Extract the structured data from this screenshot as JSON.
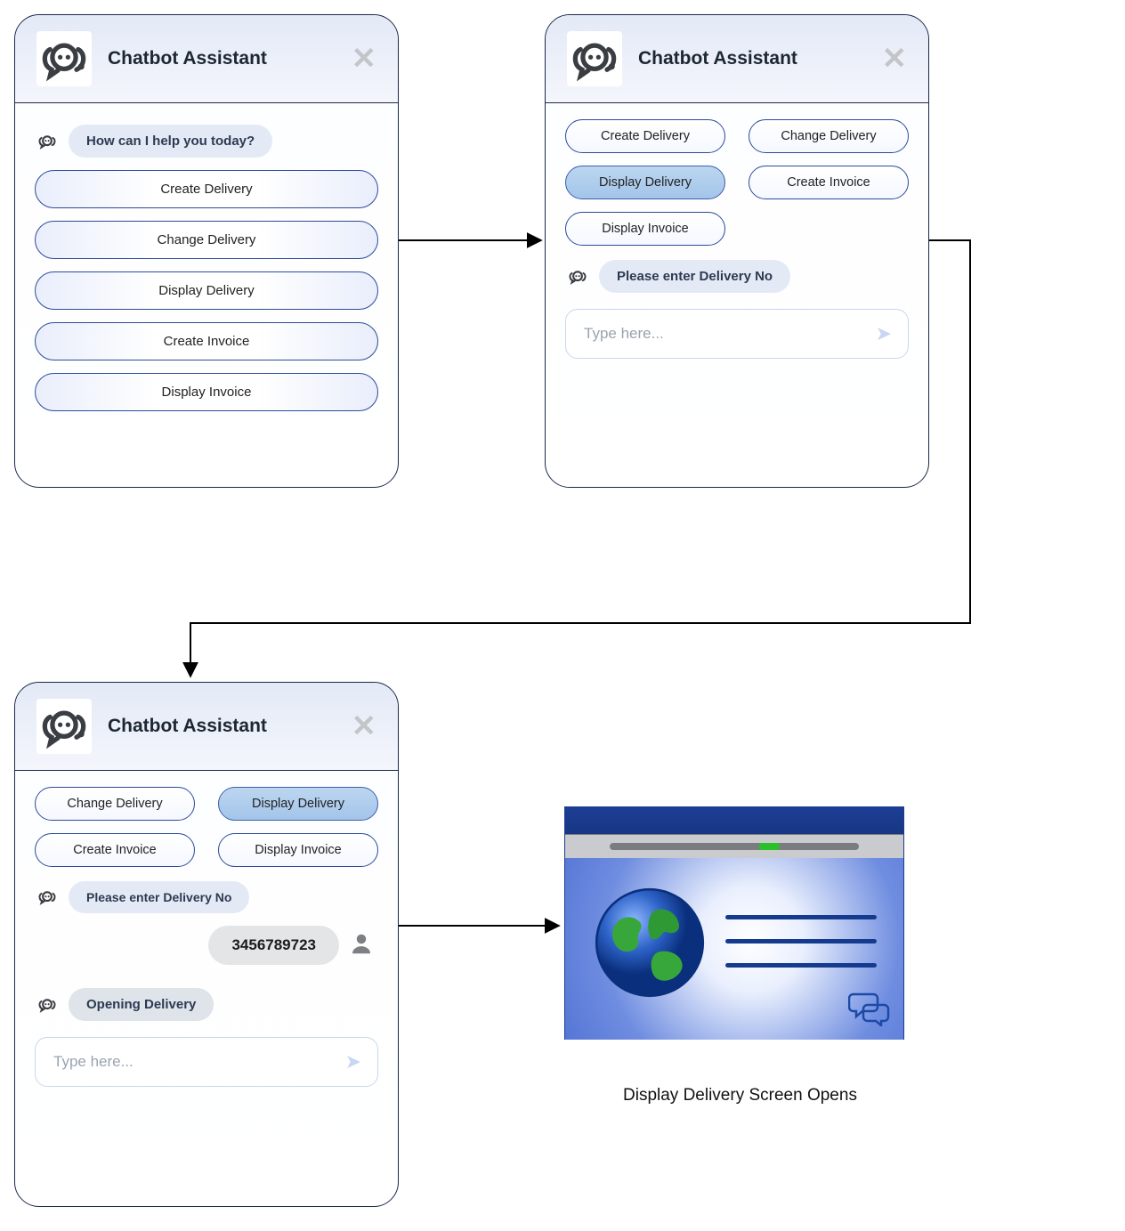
{
  "title": "Chatbot Assistant",
  "options": {
    "create_delivery": "Create Delivery",
    "change_delivery": "Change Delivery",
    "display_delivery": "Display Delivery",
    "create_invoice": "Create Invoice",
    "display_invoice": "Display Invoice"
  },
  "panel1": {
    "prompt": "How can I help you today?"
  },
  "panel2": {
    "prompt": "Please enter Delivery No",
    "placeholder": "Type here..."
  },
  "panel3": {
    "prompt": "Please enter Delivery No",
    "userEntry": "3456789723",
    "status": "Opening Delivery",
    "placeholder": "Type here..."
  },
  "result": {
    "caption": "Display Delivery Screen Opens"
  }
}
